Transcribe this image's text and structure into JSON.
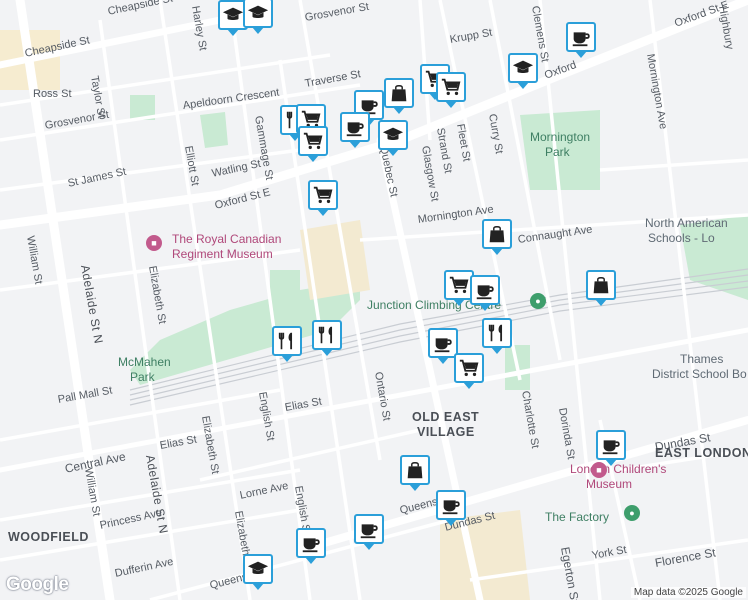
{
  "streets": {
    "cheapside_st_top": "Cheapside St",
    "cheapside_st_left": "Cheapside St",
    "grosvenor_st_top": "Grosvenor St",
    "grosvenor_st_left": "Grosvenor St",
    "krupp_st": "Krupp St",
    "oxford_st_e_top": "Oxford St E",
    "oxford_st_e_mid": "Oxford St E",
    "oxford_frag": "Oxford",
    "ross_st": "Ross St",
    "taylor_st": "Taylor St",
    "traverse_st": "Traverse St",
    "apeldoorn_crescent": "Apeldoorn Crescent",
    "gammage_st": "Gammage St",
    "watling_st": "Watling St",
    "st_james_st": "St James St",
    "elliott_st": "Elliott St",
    "harley_st": "Harley St",
    "william_st_top": "William St",
    "william_st_bottom": "William St",
    "adelaide_st_n_top": "Adelaide St N",
    "adelaide_st_n_bottom": "Adelaide St N",
    "elizabeth_st_top": "Elizabeth St",
    "elizabeth_st_mid": "Elizabeth St",
    "elizabeth_st_bottom": "Elizabeth St",
    "quebec_st": "Quebec St",
    "glasgow_st": "Glasgow St",
    "strand_st": "Strand St",
    "fleet_st": "Fleet St",
    "curry_st": "Curry St",
    "mornington_ave_mid": "Mornington Ave",
    "mornington_ave_right": "Mornington Ave",
    "connaught_ave": "Connaught Ave",
    "clemens_st": "Clemens St",
    "highbury": "Highbury",
    "pall_mall_st": "Pall Mall St",
    "english_st_mid": "English St",
    "english_st_bottom": "English St",
    "elias_st_mid": "Elias St",
    "elias_st_left": "Elias St",
    "ontario_st": "Ontario St",
    "central_ave": "Central Ave",
    "princess_ave": "Princess Ave",
    "lorne_ave": "Lorne Ave",
    "dufferin_ave": "Dufferin Ave",
    "queens_ave_mid": "Queens Ave",
    "queens_ave_left": "Queens Ave",
    "dundas_st_mid": "Dundas St",
    "dundas_st_right": "Dundas St",
    "charlotte_st": "Charlotte St",
    "dorinda_st": "Dorinda St",
    "egerton_st": "Egerton St",
    "york_st": "York St",
    "florence_st": "Florence St"
  },
  "places": {
    "royal_canadian_regiment_museum_line1": "The Royal Canadian",
    "royal_canadian_regiment_museum_line2": "Regiment Museum",
    "junction_climbing_centre": "Junction Climbing Centre",
    "mornington_park_line1": "Mornington",
    "mornington_park_line2": "Park",
    "north_american_schools_line1": "North American",
    "north_american_schools_line2": "Schools - Lo",
    "mcmahen_park_line1": "McMahen",
    "mcmahen_park_line2": "Park",
    "thames_valley_line1": "Thames",
    "thames_valley_line2": "District School Bo",
    "london_childrens_museum_line1": "London Children's",
    "london_childrens_museum_line2": "Museum",
    "the_factory": "The Factory"
  },
  "neighbourhoods": {
    "old_east_village_line1": "OLD EAST",
    "old_east_village_line2": "VILLAGE",
    "east_london": "EAST LONDON",
    "woodfield": "WOODFIELD"
  },
  "markers": [
    {
      "icon": "school-icon",
      "kind": "school"
    },
    {
      "icon": "school-icon",
      "kind": "school"
    },
    {
      "icon": "coffee-icon",
      "kind": "cafe"
    },
    {
      "icon": "school-icon",
      "kind": "school"
    },
    {
      "icon": "shopping-bag-icon",
      "kind": "shop"
    },
    {
      "icon": "shopping-cart-icon",
      "kind": "grocery"
    },
    {
      "icon": "shopping-cart-icon",
      "kind": "grocery"
    },
    {
      "icon": "coffee-icon",
      "kind": "cafe"
    },
    {
      "icon": "restaurant-icon",
      "kind": "restaurant"
    },
    {
      "icon": "shopping-cart-icon",
      "kind": "grocery"
    },
    {
      "icon": "coffee-icon",
      "kind": "cafe"
    },
    {
      "icon": "school-icon",
      "kind": "school"
    },
    {
      "icon": "shopping-cart-icon",
      "kind": "grocery"
    },
    {
      "icon": "shopping-bag-icon",
      "kind": "shop"
    },
    {
      "icon": "shopping-cart-icon",
      "kind": "grocery"
    },
    {
      "icon": "shopping-cart-icon",
      "kind": "grocery"
    },
    {
      "icon": "coffee-icon",
      "kind": "cafe"
    },
    {
      "icon": "shopping-bag-icon",
      "kind": "shop"
    },
    {
      "icon": "restaurant-icon",
      "kind": "restaurant"
    },
    {
      "icon": "coffee-icon",
      "kind": "cafe"
    },
    {
      "icon": "restaurant-icon",
      "kind": "restaurant"
    },
    {
      "icon": "restaurant-icon",
      "kind": "restaurant"
    },
    {
      "icon": "shopping-cart-icon",
      "kind": "grocery"
    },
    {
      "icon": "coffee-icon",
      "kind": "cafe"
    },
    {
      "icon": "shopping-bag-icon",
      "kind": "shop"
    },
    {
      "icon": "coffee-icon",
      "kind": "cafe"
    },
    {
      "icon": "coffee-icon",
      "kind": "cafe"
    },
    {
      "icon": "coffee-icon",
      "kind": "cafe"
    },
    {
      "icon": "school-icon",
      "kind": "school"
    }
  ],
  "colors": {
    "marker_border": "#2b9fd9",
    "park": "#c9ead3",
    "poi_green": "#3e7f63",
    "poi_pink": "#b0487a"
  },
  "branding": {
    "logo": "Google",
    "attribution": "Map data ©2025 Google"
  }
}
